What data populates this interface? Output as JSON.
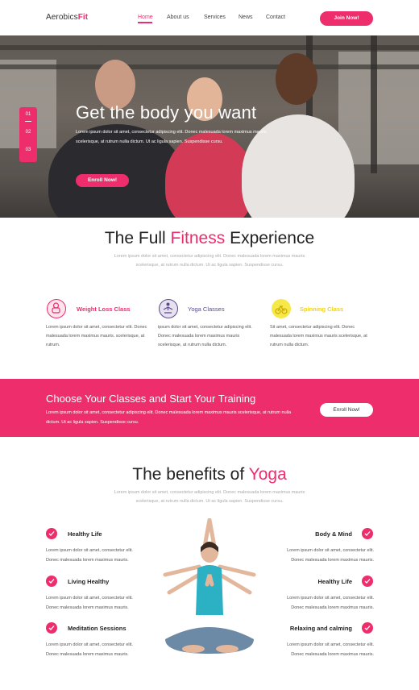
{
  "nav": {
    "logo_main": "Aerobics",
    "logo_accent": "Fit",
    "links": [
      "Home",
      "About us",
      "Services",
      "News",
      "Contact"
    ],
    "join_label": "Join Now!"
  },
  "hero": {
    "title": "Get the body you want",
    "text": "Lorem ipsum dolor sit amet, consectetur adipiscing elit. Donec malesuada lorem maximus mauris scelerisque, at rutrum nulla dictum. Ut ac ligula sapien. Suspendisse cursu.",
    "button": "Enroll Now!",
    "slides": [
      "01",
      "02",
      "03"
    ]
  },
  "fitness": {
    "title_a": "The Full ",
    "title_accent": "Fitness",
    "title_b": " Experience",
    "subtitle": "Lorem ipsum dolor sit amet, consectetur adipiscing elit. Donec malesuada lorem maximus mauris scelerisque, at rutrum nulla dictum. Ut ac ligula sapien. Suspendisse cursu.",
    "features": [
      {
        "name": "Weight Loss Class",
        "color": "#ee2d6c",
        "text": "Lorem ipsum dolor sit amet, consectetur elit. Donec malesuada lorem maximus mauris. scelerisque, at rutrum."
      },
      {
        "name": "Yoga Classes",
        "color": "#5b4a8b",
        "text": "ipsum dolor sit amet, consectetur adipiscing elit. Donec malesuada lorem maximus mauris scelerisque, at rutrum nulla dictum."
      },
      {
        "name": "Spinning Class",
        "color": "#f2d21b",
        "text": "Sit amet, consectetur adipiscing elit. Donec malesuada lorem maximus mauris scelerisque, at rutrum nulla dictum."
      }
    ]
  },
  "banner": {
    "title": "Choose Your Classes and Start Your Training",
    "text": "Lorem ipsum dolor sit amet, consectetur adipiscing elit. Donec malesuada lorem maximus mauris scelerisque, at rutrum nulla dictum. Ut ac ligula sapien. Suspendisse cursu.",
    "button": "Enroll Now!"
  },
  "yoga": {
    "title_a": "The benefits of ",
    "title_accent": "Yoga",
    "subtitle": "Lorem ipsum dolor sit amet, consectetur adipiscing elit. Donec malesuada lorem maximus mauris scelerisque, at rutrum nulla dictum. Ut ac ligula sapien. Suspendisse cursu.",
    "benefits_left": [
      {
        "name": "Healthy Life",
        "text": "Lorem ipsum dolor sit amet, consectetur elit. Donec malesuada lorem maximus mauris."
      },
      {
        "name": "Living Healthy",
        "text": "Lorem ipsum dolor sit amet, consectetur elit. Donec malesuada lorem maximus mauris."
      },
      {
        "name": "Meditation Sessions",
        "text": "Lorem ipsum dolor sit amet, consectetur elit. Donec malesuada lorem maximus mauris."
      }
    ],
    "benefits_right": [
      {
        "name": "Body & Mind",
        "text": "Lorem ipsum dolor sit amet, consectetur elit. Donec malesuada lorem maximus mauris."
      },
      {
        "name": "Healthy Life",
        "text": "Lorem ipsum dolor sit amet, consectetur elit. Donec malesuada lorem maximus mauris."
      },
      {
        "name": "Relaxing and calming",
        "text": "Lorem ipsum dolor sit amet, consectetur elit. Donec malesuada lorem maximus mauris."
      }
    ]
  },
  "colors": {
    "accent": "#ee2d6c"
  },
  "icons": [
    "weight-icon",
    "yoga-icon",
    "bike-icon",
    "check-icon"
  ]
}
